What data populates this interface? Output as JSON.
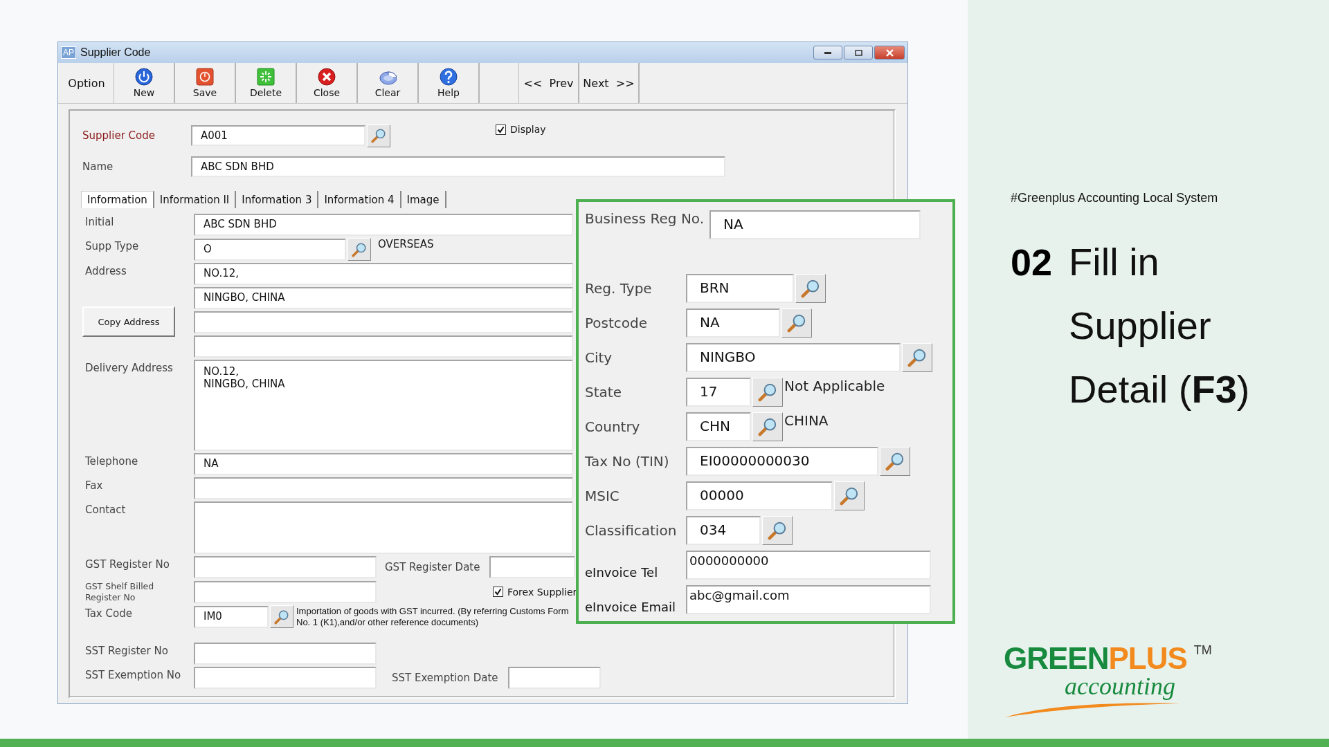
{
  "window": {
    "icon": "AP",
    "title": "Supplier Code"
  },
  "toolbar": {
    "label": "Option",
    "buttons": [
      {
        "label": "New",
        "kind": "power"
      },
      {
        "label": "Save",
        "kind": "save"
      },
      {
        "label": "Delete",
        "kind": "delete"
      },
      {
        "label": "Close",
        "kind": "close"
      },
      {
        "label": "Clear",
        "kind": "clear"
      },
      {
        "label": "Help",
        "kind": "help"
      }
    ],
    "nav": [
      "<<  Prev",
      "Next  >>"
    ]
  },
  "header": {
    "supplier_code": {
      "label": "Supplier Code",
      "value": "A001"
    },
    "name": {
      "label": "Name",
      "value": "ABC SDN BHD"
    },
    "display": {
      "label": "Display",
      "checked": true
    }
  },
  "tabs": [
    {
      "label": "Information",
      "selected": true
    },
    {
      "label": "Information II",
      "selected": false
    },
    {
      "label": "Information 3",
      "selected": false
    },
    {
      "label": "Information 4",
      "selected": false
    },
    {
      "label": "Image",
      "selected": false
    }
  ],
  "information": {
    "initial": {
      "label": "Initial",
      "value": "ABC SDN BHD"
    },
    "supp_type": {
      "label": "Supp Type",
      "value": "O",
      "description": "OVERSEAS"
    },
    "address": {
      "label": "Address",
      "lines": [
        "NO.12,",
        "NINGBO, CHINA"
      ]
    },
    "copy_address": "Copy Address",
    "delivery_address": {
      "label": "Delivery Address",
      "lines": [
        "NO.12,",
        "NINGBO, CHINA"
      ]
    },
    "telephone": {
      "label": "Telephone",
      "value": "NA"
    },
    "fax": {
      "label": "Fax"
    },
    "contact": {
      "label": "Contact"
    },
    "gst_register_no": {
      "label": "GST Register No"
    },
    "gst_register_date": {
      "label": "GST Register Date"
    },
    "gst_shelf_billed": {
      "label": "GST Shelf Billed Register No"
    },
    "forex_supplier": {
      "label": "Forex Supplier",
      "checked": true
    },
    "tax_code": {
      "label": "Tax Code",
      "value": "IM0",
      "description": "Importation of goods with GST incurred. (By referring Customs Form No. 1 (K1),and/or other reference documents)"
    },
    "sst_register_no": {
      "label": "SST Register No"
    },
    "sst_exemption_no": {
      "label": "SST Exemption No"
    },
    "sst_exemption_date": {
      "label": "SST Exemption Date"
    }
  },
  "highlight_panel": {
    "fields": [
      {
        "label": "Business Reg No.",
        "value": "NA",
        "kind": "text"
      },
      {
        "label": "Reg. Type",
        "value": "BRN",
        "kind": "lookup"
      },
      {
        "label": "Postcode",
        "value": "NA",
        "kind": "lookup"
      },
      {
        "label": "City",
        "value": "NINGBO",
        "kind": "lookup"
      },
      {
        "label": "State",
        "value": "17",
        "kind": "lookup",
        "description": "Not Applicable"
      },
      {
        "label": "Country",
        "value": "CHN",
        "kind": "lookup",
        "description": "CHINA"
      },
      {
        "label": "Tax No (TIN)",
        "value": "EI00000000030",
        "kind": "lookup"
      },
      {
        "label": "MSIC",
        "value": "00000",
        "kind": "lookup"
      },
      {
        "label": "Classification",
        "value": "034",
        "kind": "lookup"
      },
      {
        "label": "eInvoice Tel",
        "value": "0000000000",
        "kind": "text"
      },
      {
        "label": "eInvoice Email",
        "value": "abc@gmail.com",
        "kind": "text"
      }
    ]
  },
  "slide": {
    "tag": "#Greenplus Accounting Local System",
    "step": "02",
    "heading": "Fill in Supplier Detail (**F3**)"
  },
  "logo": {
    "brand_primary": "GREEN",
    "brand_secondary": "PLUS",
    "trademark": "TM",
    "tagline": "accounting"
  }
}
